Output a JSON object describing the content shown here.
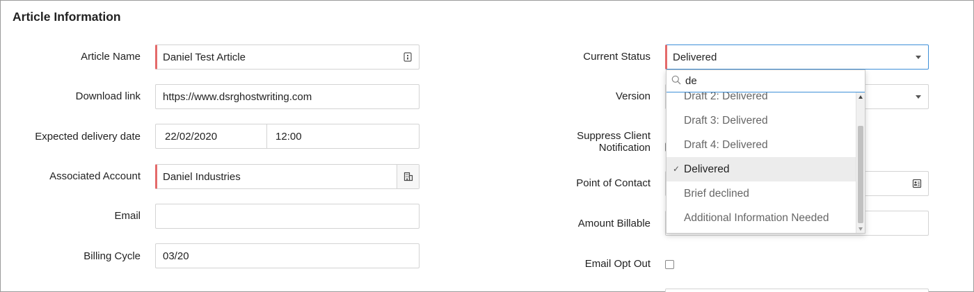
{
  "section": {
    "title": "Article Information"
  },
  "left": {
    "article_name": {
      "label": "Article Name",
      "value": "Daniel Test Article",
      "icon": "id-card-icon"
    },
    "download_link": {
      "label": "Download link",
      "value": "https://www.dsrghostwriting.com"
    },
    "expected_delivery": {
      "label": "Expected delivery date",
      "date": "22/02/2020",
      "time": "12:00"
    },
    "associated_account": {
      "label": "Associated Account",
      "value": "Daniel Industries",
      "icon": "building-icon"
    },
    "email": {
      "label": "Email",
      "value": ""
    },
    "billing_cycle": {
      "label": "Billing Cycle",
      "value": "03/20"
    }
  },
  "right": {
    "current_status": {
      "label": "Current Status",
      "value": "Delivered"
    },
    "version": {
      "label": "Version"
    },
    "suppress_client": {
      "label_line1": "Suppress Client",
      "label_line2": "Notification"
    },
    "point_of_contact": {
      "label": "Point of Contact",
      "icon": "contact-card-icon"
    },
    "amount_billable": {
      "label": "Amount Billable"
    },
    "email_opt_out": {
      "label": "Email Opt Out",
      "checked": false
    }
  },
  "status_dropdown": {
    "search_value": "de",
    "options": [
      {
        "label": "Draft 2: Delivered",
        "selected": false
      },
      {
        "label": "Draft 3: Delivered",
        "selected": false
      },
      {
        "label": "Draft 4: Delivered",
        "selected": false
      },
      {
        "label": "Delivered",
        "selected": true
      },
      {
        "label": "Brief declined",
        "selected": false
      },
      {
        "label": "Additional Information Needed",
        "selected": false
      }
    ],
    "check_glyph": "✓"
  },
  "colors": {
    "required_marker": "#e46a6a",
    "focus": "#3d8fd8",
    "border": "#d3d3d3"
  }
}
